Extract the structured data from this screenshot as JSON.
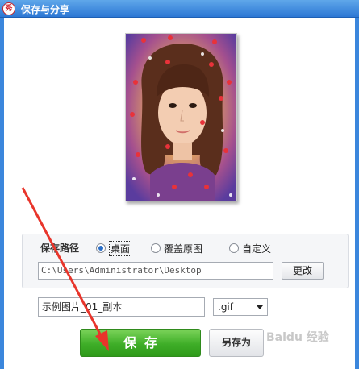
{
  "window": {
    "title": "保存与分享",
    "icon": "xiuxiu-app-icon",
    "icon_text": "秀"
  },
  "preview": {
    "description_icon": "photo-preview",
    "colors": {
      "accent": "#d21f2a",
      "hair": "#5a2e1c"
    }
  },
  "save_path": {
    "label": "保存路径",
    "options": [
      {
        "label": "桌面",
        "selected": true
      },
      {
        "label": "覆盖原图",
        "selected": false
      },
      {
        "label": "自定义",
        "selected": false
      }
    ],
    "path_value": "C:\\Users\\Administrator\\Desktop",
    "change_button": "更改"
  },
  "file": {
    "name_value": "示例图片_01_副本",
    "format_selected": ".gif"
  },
  "actions": {
    "save_label": "保存",
    "save_as_label": "另存为"
  },
  "watermark": "Baidu 经验",
  "colors": {
    "titlebar": "#2c77d4",
    "save_button": "#3fae28",
    "arrow": "#e8352b"
  }
}
